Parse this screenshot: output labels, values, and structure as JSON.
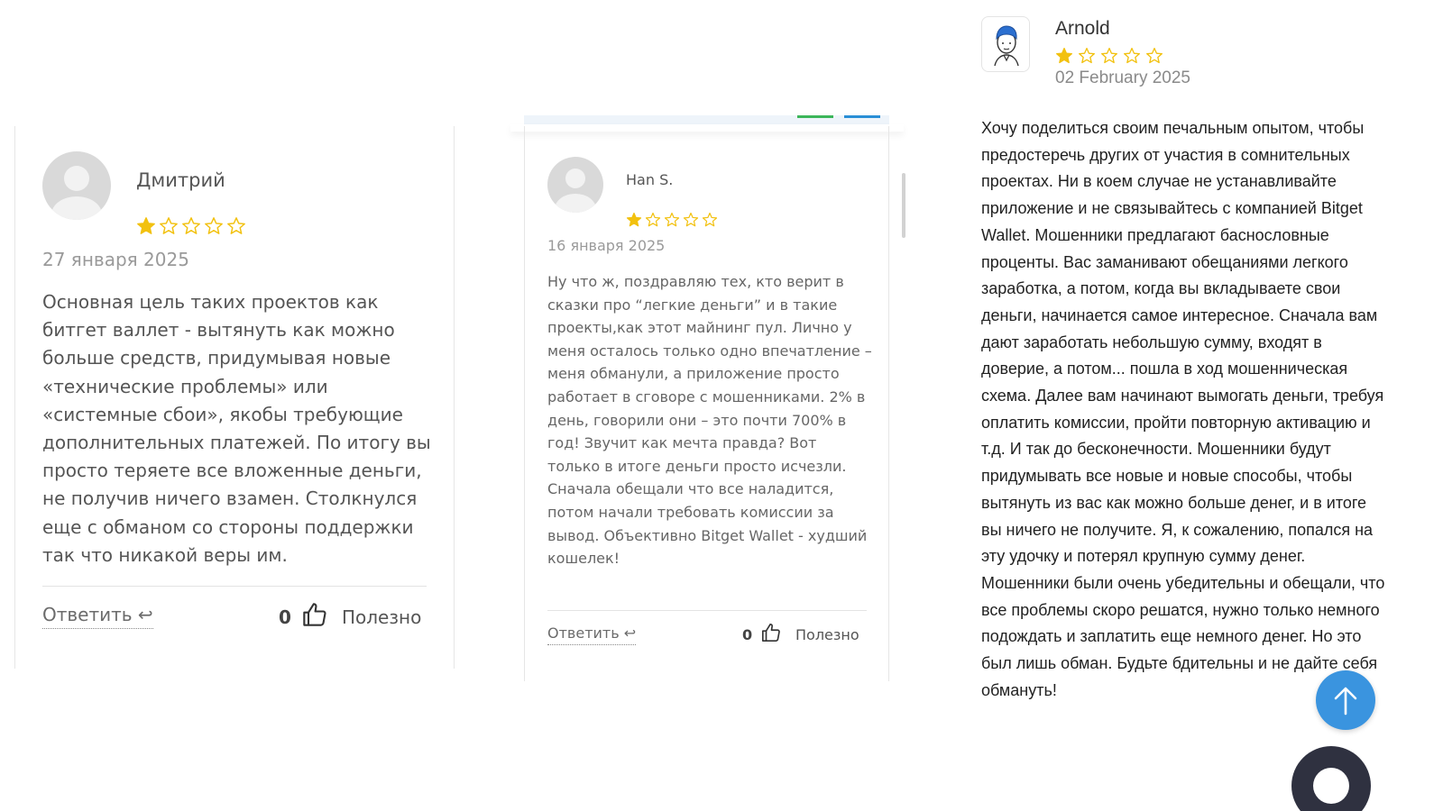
{
  "reviews": [
    {
      "author": "Дмитрий",
      "rating": 1,
      "rating_max": 5,
      "date": "27 января 2025",
      "text": "Основная цель таких проектов как битгет валлет - вытянуть как можно больше средств, придумывая новые «технические проблемы» или «системные сбои», якобы требующие дополнительных платежей. По итогу вы просто теряете все вложенные деньги, не получив ничего взамен. Столкнулся еще с обманом со стороны поддержки так что никакой веры им.",
      "reply_label": "Ответить ↩",
      "likes": "0",
      "useful_label": "Полезно"
    },
    {
      "author": "Han S.",
      "rating": 1,
      "rating_max": 5,
      "date": "16 января 2025",
      "text": "Ну что ж, поздравляю тех, кто верит в сказки про “легкие деньги” и в такие проекты,как этот майнинг пул. Лично у меня осталось только одно впечатление – меня обманули, а приложение просто работает в сговоре с мошенниками. 2% в день, говорили они – это почти 700% в год! Звучит как мечта правда? Вот только в итоге деньги просто исчезли. Сначала обещали что все наладится, потом начали требовать комиссии за вывод. Объективно Bitget Wallet - худший кошелек!",
      "reply_label": "Ответить ↩",
      "likes": "0",
      "useful_label": "Полезно"
    },
    {
      "author": "Arnold",
      "rating": 1,
      "rating_max": 5,
      "date": "02 February 2025",
      "text": "Хочу поделиться своим печальным опытом, чтобы предостеречь других от участия в сомнительных проектах. Ни в коем случае не устанавливайте приложение и не связывайтесь с компанией Bitget Wallet. Мошенники предлагают баснословные проценты. Вас заманивают обещаниями легкого заработка, а потом, когда вы вкладываете свои деньги, начинается самое интересное. Сначала вам дают заработать небольшую сумму, входят в доверие, а потом... пошла в ход мошенническая схема. Далее вам начинают вымогать деньги, требуя оплатить комиссии, пройти повторную активацию и т.д. И так до бесконечности. Мошенники будут придумывать все новые и новые способы, чтобы вытянуть из вас как можно больше денег, и в итоге вы ничего не получите. Я, к сожалению, попался на эту удочку и потерял крупную сумму денег. Мошенники были очень убедительны и обещали, что все проблемы скоро решатся, нужно только немного подождать и заплатить еще немного денег. Но это был лишь обман. Будьте бдительны и не дайте себя обмануть!"
    }
  ],
  "colors": {
    "star": "#f2c10f",
    "accent_green": "#3cb65a",
    "accent_blue": "#2a8fd6",
    "scroll_top_button": "#3a94df",
    "chat_bubble": "#2f3140"
  },
  "icons": {
    "scroll_top": "arrow-up-icon",
    "like": "thumbs-up-icon",
    "chat": "chat-icon"
  }
}
